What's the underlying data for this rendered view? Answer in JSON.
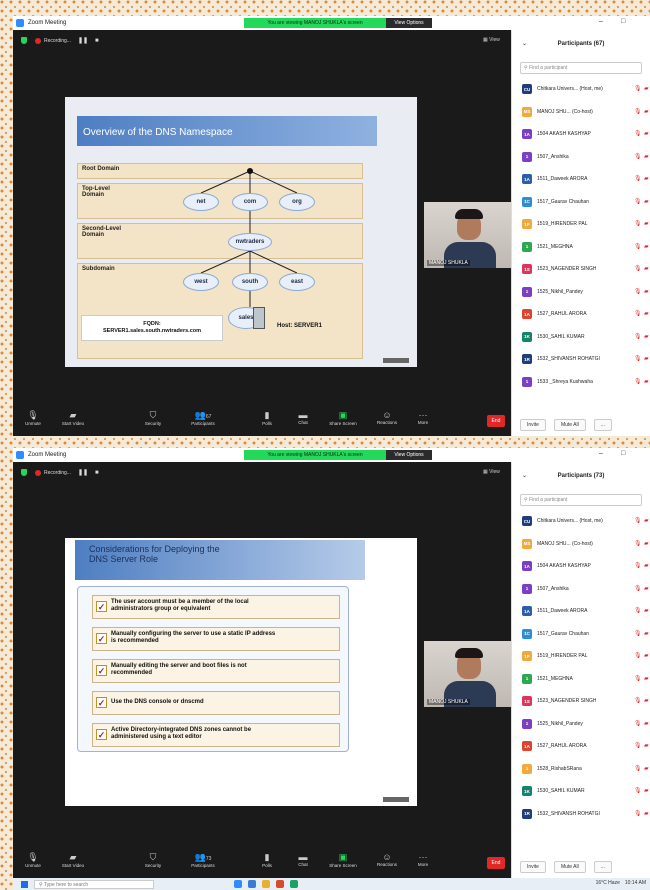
{
  "window1": {
    "title": "Zoom Meeting",
    "viewing_banner": "You are viewing MANOJ SHUKLA's screen",
    "view_options": "View Options",
    "recording_label": "Recording...",
    "view_label": "View",
    "participants_header": "Participants (67)",
    "search_placeholder": "Find a participant",
    "participants": [
      {
        "initials": "CU",
        "name": "Chitkara Univers... (Host, me)",
        "color": "#1f3d7a"
      },
      {
        "initials": "MS",
        "name": "MANOJ SHU... (Co-host)",
        "color": "#f2a83b"
      },
      {
        "initials": "1A",
        "name": "1504 AKASH KASHYAP",
        "color": "#7b3fc4"
      },
      {
        "initials": "1",
        "name": "1507_Anshika",
        "color": "#7b3fc4"
      },
      {
        "initials": "1A",
        "name": "1511_Daweek ARORA",
        "color": "#2b5fa8"
      },
      {
        "initials": "1C",
        "name": "1517_Gaurav Chauhan",
        "color": "#2b8fd6"
      },
      {
        "initials": "1P",
        "name": "1519_HIRENDER PAL",
        "color": "#f2a83b"
      },
      {
        "initials": "1",
        "name": "1521_MEGHNA",
        "color": "#2da84f"
      },
      {
        "initials": "1S",
        "name": "1523_NAGENDER SINGH",
        "color": "#d9365a"
      },
      {
        "initials": "1",
        "name": "1525_Nikhil_Pandey",
        "color": "#7b3fc4"
      },
      {
        "initials": "1A",
        "name": "1527_RAHUL ARORA",
        "color": "#e0432b"
      },
      {
        "initials": "1K",
        "name": "1530_SAHIL KUMAR",
        "color": "#16826b"
      },
      {
        "initials": "1R",
        "name": "1532_SHIVANSH ROHATGI",
        "color": "#1f3d7a"
      },
      {
        "initials": "1",
        "name": "1533 _Shreya Kushwaha",
        "color": "#7b3fc4"
      }
    ],
    "invite_label": "Invite",
    "mute_all_label": "Mute All",
    "more_label": "...",
    "slide": {
      "title": "Overview of the DNS Namespace",
      "root_domain": "Root Domain",
      "tld_line1": "Top-Level",
      "tld_line2": "Domain",
      "sld_line1": "Second-Level",
      "sld_line2": "Domain",
      "subdomain": "Subdomain",
      "net": "net",
      "com": "com",
      "org": "org",
      "nwtraders": "nwtraders",
      "west": "west",
      "south": "south",
      "east": "east",
      "sales": "sales",
      "fqdn_label": "FQDN:",
      "fqdn_value": "SERVER1.sales.south.nwtraders.com",
      "host": "Host: SERVER1"
    },
    "video_name": "MANOJ SHUKLA",
    "toolbar": {
      "unmute": "Unmute",
      "start_video": "Start Video",
      "security": "Security",
      "participants": "Participants",
      "participants_count": "67",
      "polls": "Polls",
      "chat": "Chat",
      "share_screen": "Share Screen",
      "reactions": "Reactions",
      "more": "More",
      "end": "End"
    }
  },
  "window2": {
    "title": "Zoom Meeting",
    "viewing_banner": "You are viewing MANOJ SHUKLA's screen",
    "view_options": "View Options",
    "recording_label": "Recording...",
    "view_label": "View",
    "participants_header": "Participants (73)",
    "search_placeholder": "Find a participant",
    "participants": [
      {
        "initials": "CU",
        "name": "Chitkara Univers... (Host, me)",
        "color": "#1f3d7a"
      },
      {
        "initials": "MS",
        "name": "MANOJ SHU... (Co-host)",
        "color": "#f2a83b"
      },
      {
        "initials": "1A",
        "name": "1504 AKASH KASHYAP",
        "color": "#7b3fc4"
      },
      {
        "initials": "1",
        "name": "1507_Anshika",
        "color": "#7b3fc4"
      },
      {
        "initials": "1A",
        "name": "1511_Daweek ARORA",
        "color": "#2b5fa8"
      },
      {
        "initials": "1C",
        "name": "1517_Gaurav Chauhan",
        "color": "#2b8fd6"
      },
      {
        "initials": "1P",
        "name": "1519_HIRENDER PAL",
        "color": "#f2a83b"
      },
      {
        "initials": "1",
        "name": "1521_MEGHNA",
        "color": "#2da84f"
      },
      {
        "initials": "1S",
        "name": "1523_NAGENDER SINGH",
        "color": "#d9365a"
      },
      {
        "initials": "1",
        "name": "1525_Nikhil_Pandey",
        "color": "#7b3fc4"
      },
      {
        "initials": "1A",
        "name": "1527_RAHUL ARORA",
        "color": "#e0432b"
      },
      {
        "initials": "1",
        "name": "1528_RishabSRana",
        "color": "#f2a83b"
      },
      {
        "initials": "1K",
        "name": "1530_SAHIL KUMAR",
        "color": "#16826b"
      },
      {
        "initials": "1R",
        "name": "1532_SHIVANSH ROHATGI",
        "color": "#1f3d7a"
      }
    ],
    "invite_label": "Invite",
    "mute_all_label": "Mute All",
    "more_label": "...",
    "slide": {
      "title_line1": "Considerations for Deploying the",
      "title_line2": "DNS Server Role",
      "points": [
        {
          "l1": "The user account must be a member of the local",
          "l2": "administrators group or equivalent"
        },
        {
          "l1": "Manually configuring the server to use a static IP address",
          "l2": "is recommended"
        },
        {
          "l1": "Manually editing the server and boot files is not",
          "l2": "recommended"
        },
        {
          "l1": "Use the DNS console or dnscmd",
          "l2": ""
        },
        {
          "l1": "Active Directory-integrated DNS zones cannot be",
          "l2": "administered using a text editor"
        }
      ]
    },
    "video_name": "MANOJ SHUKLA",
    "toolbar": {
      "unmute": "Unmute",
      "start_video": "Start Video",
      "security": "Security",
      "participants": "Participants",
      "participants_count": "73",
      "polls": "Polls",
      "chat": "Chat",
      "share_screen": "Share Screen",
      "reactions": "Reactions",
      "more": "More",
      "end": "End"
    },
    "taskbar": {
      "search_placeholder": "Type here to search",
      "weather": "16°C Haze",
      "time": "10:14 AM"
    }
  }
}
